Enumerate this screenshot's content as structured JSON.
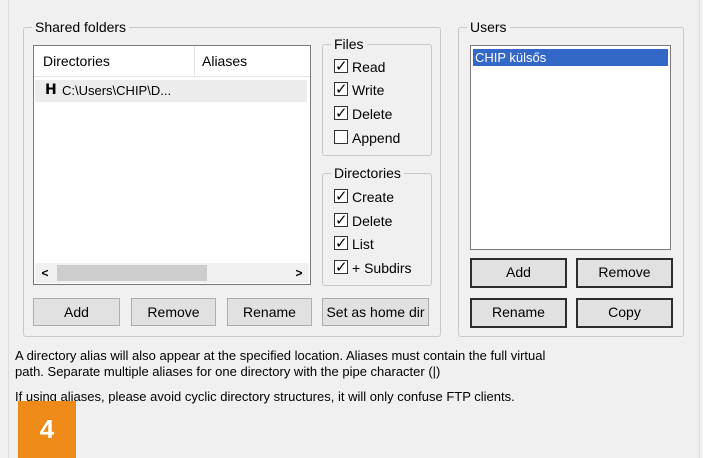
{
  "shared_folders": {
    "title": "Shared folders",
    "columns": [
      "Directories",
      "Aliases"
    ],
    "rows": [
      {
        "flag": "H",
        "directory": "C:\\Users\\CHIP\\D...",
        "alias": ""
      }
    ],
    "scroll_left": "<",
    "scroll_right": ">"
  },
  "files": {
    "title": "Files",
    "options": [
      {
        "label": "Read",
        "checked": true
      },
      {
        "label": "Write",
        "checked": true
      },
      {
        "label": "Delete",
        "checked": true
      },
      {
        "label": "Append",
        "checked": false
      }
    ]
  },
  "directories": {
    "title": "Directories",
    "options": [
      {
        "label": "Create",
        "checked": true
      },
      {
        "label": "Delete",
        "checked": true
      },
      {
        "label": "List",
        "checked": true
      },
      {
        "label": "+ Subdirs",
        "checked": true
      }
    ]
  },
  "folder_buttons": {
    "add": "Add",
    "remove": "Remove",
    "rename": "Rename",
    "set_home": "Set as home dir"
  },
  "users": {
    "title": "Users",
    "items": [
      "CHIP külsős"
    ],
    "buttons": {
      "add": "Add",
      "remove": "Remove",
      "rename": "Rename",
      "copy": "Copy"
    }
  },
  "info": {
    "line1": "A directory alias will also appear at the specified location. Aliases must contain the full virtual",
    "line2": "path. Separate multiple aliases for one directory with the pipe character (|)",
    "line3": "If using aliases, please avoid cyclic directory structures, it will only confuse FTP clients."
  },
  "badge": "4"
}
